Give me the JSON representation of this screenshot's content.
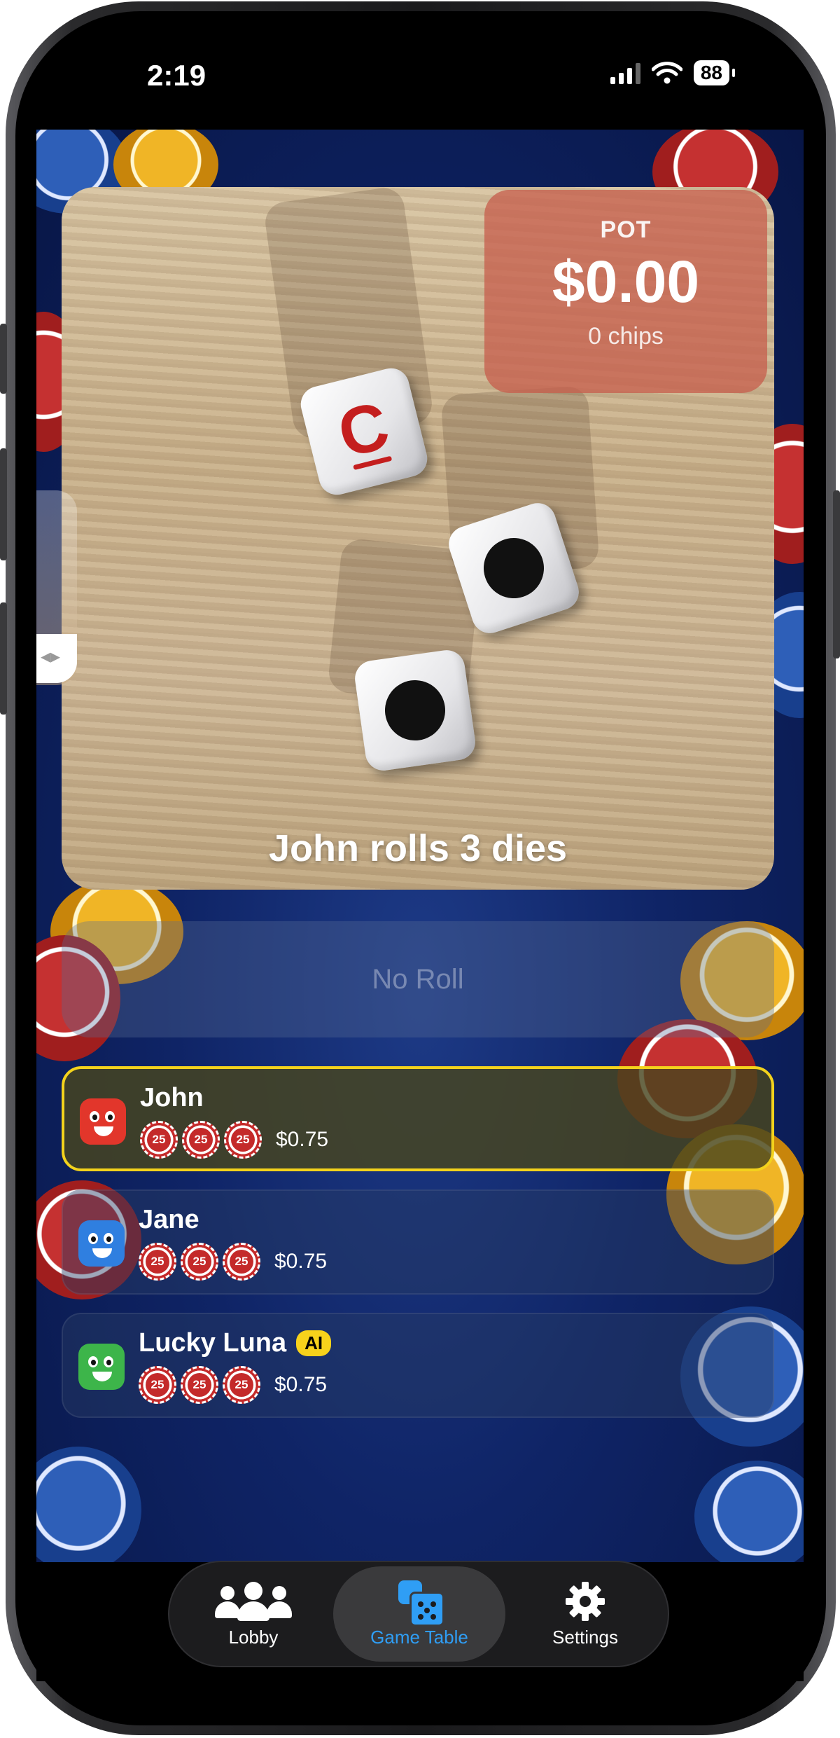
{
  "status_bar": {
    "time": "2:19",
    "battery": "88"
  },
  "board": {
    "pot_label": "POT",
    "pot_amount": "$0.00",
    "pot_chips": "0 chips",
    "die_letter": "C",
    "caption": "John rolls 3 dies"
  },
  "roll_button": {
    "label": "No Roll"
  },
  "players": [
    {
      "name": "John",
      "balance": "$0.75",
      "chips": [
        "25",
        "25",
        "25"
      ],
      "avatar_color": "#e2362b",
      "badge": ""
    },
    {
      "name": "Jane",
      "balance": "$0.75",
      "chips": [
        "25",
        "25",
        "25"
      ],
      "avatar_color": "#2f7fe0",
      "badge": ""
    },
    {
      "name": "Lucky Luna",
      "balance": "$0.75",
      "chips": [
        "25",
        "25",
        "25"
      ],
      "avatar_color": "#3db54a",
      "badge": "AI"
    }
  ],
  "tabs": [
    {
      "label": "Lobby",
      "icon": "people-icon"
    },
    {
      "label": "Game Table",
      "icon": "dice-icon"
    },
    {
      "label": "Settings",
      "icon": "gear-icon"
    }
  ],
  "colors": {
    "active_border": "#f3d21c",
    "accent": "#2f9ef5",
    "pot_bg": "#c6604e"
  }
}
